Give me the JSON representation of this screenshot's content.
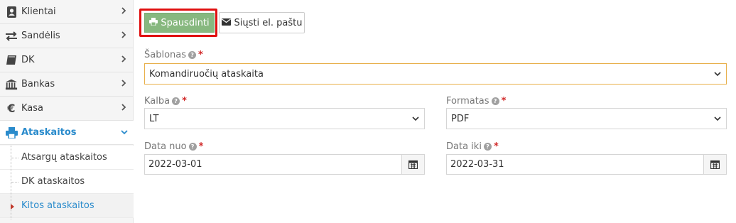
{
  "sidebar": {
    "items": [
      {
        "label": "Klientai",
        "icon": "contact-card-icon"
      },
      {
        "label": "Sandėlis",
        "icon": "exchange-arrows-icon"
      },
      {
        "label": "DK",
        "icon": "book-icon"
      },
      {
        "label": "Bankas",
        "icon": "bank-icon"
      },
      {
        "label": "Kasa",
        "icon": "euro-icon"
      },
      {
        "label": "Ataskaitos",
        "icon": "printer-icon"
      }
    ],
    "subitems": [
      {
        "label": "Atsargų ataskaitos"
      },
      {
        "label": "DK ataskaitos"
      },
      {
        "label": "Kitos ataskaitos"
      }
    ],
    "active_color": "#2a8bcc"
  },
  "toolbar": {
    "print_label": "Spausdinti",
    "email_label": "Siųsti el. paštu",
    "print_color": "#87b87f",
    "highlight_color": "#e01010"
  },
  "form": {
    "template": {
      "label": "Šablonas",
      "value": "Komandiruočių ataskaita"
    },
    "language": {
      "label": "Kalba",
      "value": "LT"
    },
    "format": {
      "label": "Formatas",
      "value": "PDF"
    },
    "date_from": {
      "label": "Data nuo",
      "value": "2022-03-01"
    },
    "date_to": {
      "label": "Data iki",
      "value": "2022-03-31"
    }
  }
}
